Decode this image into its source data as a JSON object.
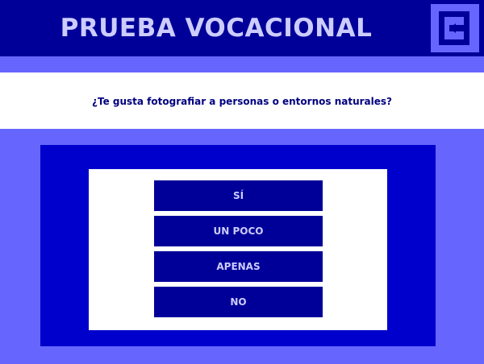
{
  "header": {
    "title": "PRUEBA VOCACIONAL",
    "back_icon": "return-arrow-icon"
  },
  "question": {
    "text": "¿Te gusta fotografiar a personas o entornos naturales?"
  },
  "answers": [
    {
      "label": "SÍ"
    },
    {
      "label": "UN POCO"
    },
    {
      "label": "APENAS"
    },
    {
      "label": "NO"
    }
  ],
  "colors": {
    "page_background": "#6666ff",
    "header_background": "#000099",
    "title_text": "#ccccff",
    "question_text": "#000080",
    "answers_frame": "#0000cc",
    "answer_button": "#000099",
    "answer_text": "#ccccff"
  }
}
